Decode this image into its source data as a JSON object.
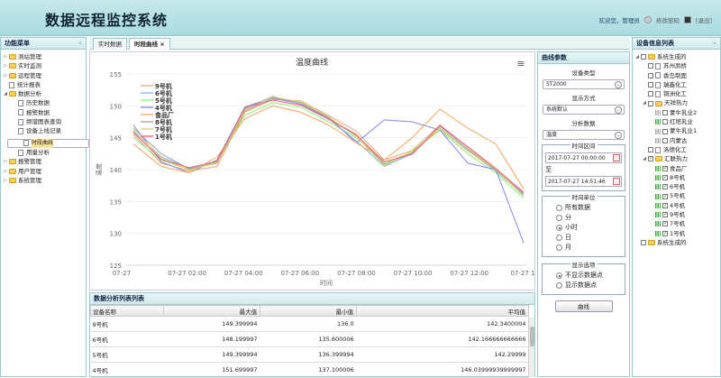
{
  "header": {
    "title": "数据远程监控系统",
    "welcome": "欢迎您，管理员",
    "change_pwd": "修改密码",
    "logout": "[退出]"
  },
  "left": {
    "title": "功能菜单",
    "items": [
      {
        "label": "测站管理",
        "level": 0,
        "type": "folder",
        "twist": "▷"
      },
      {
        "label": "实时监测",
        "level": 0,
        "type": "folder",
        "twist": "▷"
      },
      {
        "label": "远程管理",
        "level": 0,
        "type": "folder",
        "twist": "▷"
      },
      {
        "label": "统计报表",
        "level": 0,
        "type": "doc",
        "twist": ""
      },
      {
        "label": "数据分析",
        "level": 0,
        "type": "folder",
        "twist": "◢"
      },
      {
        "label": "历史数据",
        "level": 1,
        "type": "doc",
        "twist": ""
      },
      {
        "label": "报警数据",
        "level": 1,
        "type": "doc",
        "twist": ""
      },
      {
        "label": "频谱图表查询",
        "level": 1,
        "type": "doc",
        "twist": ""
      },
      {
        "label": "设备上线记录",
        "level": 1,
        "type": "doc",
        "twist": ""
      },
      {
        "label": "时段曲线",
        "level": 1,
        "type": "doc",
        "twist": "",
        "selected": true
      },
      {
        "label": "用量分析",
        "level": 1,
        "type": "doc",
        "twist": ""
      },
      {
        "label": "报警管理",
        "level": 0,
        "type": "folder",
        "twist": "▷"
      },
      {
        "label": "用户管理",
        "level": 0,
        "type": "folder",
        "twist": "▷"
      },
      {
        "label": "系统管理",
        "level": 0,
        "type": "folder",
        "twist": "▷"
      }
    ]
  },
  "tabs": [
    {
      "label": "实时数据",
      "active": false
    },
    {
      "label": "时段曲线",
      "active": true,
      "closable": "×"
    }
  ],
  "chart_data": {
    "type": "line",
    "title": "温度曲线",
    "xlabel": "时间",
    "ylabel": "温度",
    "ylim": [
      125,
      155
    ],
    "yticks": [
      125,
      130,
      135,
      140,
      145,
      150,
      155
    ],
    "x": [
      "07-27",
      "07-27 02:00",
      "07-27 04:00",
      "07-27 06:00",
      "07-27 08:00",
      "07-27 10:00",
      "07-27 12:00",
      "07-27 1..."
    ],
    "menu_icon": "≡",
    "series": [
      {
        "name": "9号机",
        "color": "#e8a87c",
        "values": [
          145.5,
          141,
          139.8,
          140.5,
          149,
          151,
          150.8,
          148.5,
          146,
          141.5,
          143,
          147,
          143.5,
          140,
          136.5
        ]
      },
      {
        "name": "6号机",
        "color": "#7cb5ec",
        "values": [
          146,
          142,
          140.2,
          141,
          149.5,
          151.5,
          150.2,
          148,
          144.5,
          140.5,
          142.5,
          146.5,
          143,
          139.8,
          136
        ]
      },
      {
        "name": "5号机",
        "color": "#90ed7d",
        "values": [
          145,
          141.5,
          140,
          141.2,
          148.5,
          150.5,
          149.8,
          147.5,
          145,
          141,
          142.8,
          146.2,
          142.5,
          139.5,
          135.5
        ]
      },
      {
        "name": "4号机",
        "color": "#8085e9",
        "values": [
          147,
          141.2,
          139.5,
          141.5,
          149.8,
          151.3,
          150.5,
          148.2,
          144.2,
          147.8,
          147.5,
          146.2,
          141,
          140,
          128.5
        ]
      },
      {
        "name": "食品厂",
        "color": "#f7a35c",
        "values": [
          144,
          140.5,
          139.5,
          142,
          148,
          150,
          149,
          147,
          144.2,
          141.5,
          145,
          149.5,
          146.5,
          144,
          137
        ]
      },
      {
        "name": "8号机",
        "color": "#a0a0a0",
        "values": [
          146.5,
          142.5,
          140.1,
          141,
          149.2,
          151.2,
          150.3,
          148.1,
          145.5,
          140.8,
          142.6,
          146.8,
          143.2,
          139.9,
          136.2
        ]
      },
      {
        "name": "7号机",
        "color": "#e4d354",
        "values": [
          146.2,
          141.8,
          139.9,
          141.1,
          149.4,
          151.4,
          150.6,
          148.3,
          145.2,
          140.6,
          142.9,
          146.4,
          142.9,
          140.1,
          135.8
        ]
      },
      {
        "name": "1号机",
        "color": "#f15c80",
        "values": [
          145.8,
          141.6,
          140.3,
          141.3,
          149.7,
          150.9,
          150.1,
          147.9,
          145.4,
          141.2,
          142.4,
          146.9,
          143.6,
          140.2,
          136.4
        ]
      }
    ]
  },
  "params": {
    "title": "曲线参数",
    "device_type_label": "设备类型",
    "device_type": "ST2000",
    "display_label": "显示方式",
    "display": "系统默认",
    "analysis_label": "分析数据",
    "analysis": "温度",
    "time_range_label": "时间区间",
    "start": "2017-07-27 00:00:00",
    "to": "至",
    "end": "2017-07-27 14:51:46",
    "unit_label": "时间单位",
    "units": [
      {
        "label": "所有数据",
        "on": false
      },
      {
        "label": "分",
        "on": false
      },
      {
        "label": "小时",
        "on": true
      },
      {
        "label": "日",
        "on": false
      },
      {
        "label": "月",
        "on": false
      }
    ],
    "display_opt_label": "显示选项",
    "display_opts": [
      {
        "label": "不显示数据点",
        "on": true
      },
      {
        "label": "显示数据点",
        "on": false
      }
    ],
    "button": "曲线"
  },
  "table": {
    "title": "数据分析列表列表",
    "headers": [
      "设备名称",
      "最大值",
      "最小值",
      "平均值"
    ],
    "rows": [
      [
        "9号机",
        "149.399994",
        "136.0",
        "142.3400004"
      ],
      [
        "6号机",
        "148.199997",
        "135.600006",
        "142.166666666666"
      ],
      [
        "5号机",
        "149.399994",
        "136.399994",
        "142.29999"
      ],
      [
        "4号机",
        "151.699997",
        "137.100006",
        "146.03999939999997"
      ]
    ]
  },
  "right": {
    "title": "设备信息列表",
    "items": [
      {
        "label": "系统生成的",
        "level": 0,
        "kind": "folder",
        "twist": "◢"
      },
      {
        "label": "苏州凤桥",
        "level": 1,
        "kind": "doc"
      },
      {
        "label": "香岛制面",
        "level": 1,
        "kind": "doc"
      },
      {
        "label": "瑞鑫化工",
        "level": 1,
        "kind": "doc"
      },
      {
        "label": "铜洲化工",
        "level": 1,
        "kind": "doc"
      },
      {
        "label": "天祥热力",
        "level": 1,
        "kind": "folder",
        "twist": "◢"
      },
      {
        "label": "蒙牛乳业2",
        "level": 2,
        "kind": "dev",
        "weak": true
      },
      {
        "label": "红塔乳业",
        "level": 2,
        "kind": "dev",
        "weak": false
      },
      {
        "label": "蒙牛乳业1",
        "level": 2,
        "kind": "dev",
        "weak": true
      },
      {
        "label": "内蒙古",
        "level": 2,
        "kind": "dev",
        "weak": true
      },
      {
        "label": "洛德化工",
        "level": 1,
        "kind": "doc"
      },
      {
        "label": "汇联热力",
        "level": 1,
        "kind": "folder",
        "twist": "◢",
        "checked": true
      },
      {
        "label": "食品厂",
        "level": 2,
        "kind": "dev",
        "checked": true
      },
      {
        "label": "8号机",
        "level": 2,
        "kind": "dev",
        "checked": true
      },
      {
        "label": "6号机",
        "level": 2,
        "kind": "dev",
        "checked": true
      },
      {
        "label": "5号机",
        "level": 2,
        "kind": "dev",
        "checked": true
      },
      {
        "label": "4号机",
        "level": 2,
        "kind": "dev",
        "checked": true
      },
      {
        "label": "9号机",
        "level": 2,
        "kind": "dev",
        "checked": true
      },
      {
        "label": "7号机",
        "level": 2,
        "kind": "dev",
        "checked": true
      },
      {
        "label": "1号机",
        "level": 2,
        "kind": "dev",
        "checked": true
      },
      {
        "label": "系统生成的",
        "level": 0,
        "kind": "folder",
        "twist": ""
      }
    ]
  }
}
